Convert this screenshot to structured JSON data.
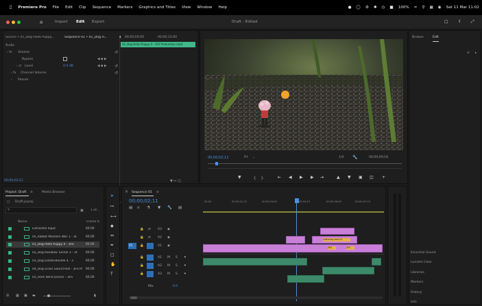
{
  "menubar": {
    "app_name": "Premiere Pro",
    "items": [
      "File",
      "Edit",
      "Clip",
      "Sequence",
      "Markers",
      "Graphics and Titles",
      "View",
      "Window",
      "Help"
    ],
    "battery": "100%",
    "datetime": "Sat 11 Mar 11:02"
  },
  "app_header": {
    "tabs": [
      "Import",
      "Edit",
      "Export"
    ],
    "active_tab": "Edit",
    "doc_title": "Draft - Edited"
  },
  "effect_controls": {
    "source_label": "Source • 01_Dog Hello Puppy...",
    "sequence_label": "Sequence 01 • 01_Dog H...",
    "time_start": "00;00;00;00",
    "time_end": "00;00;15;00",
    "clip_name": "01_Dog Hello Puppy 4 - 3FS Production.mp4",
    "audio_heading": "Audio",
    "volume_label": "Volume",
    "bypass_label": "Bypass",
    "level_label": "Level",
    "level_value": "0.0 dB",
    "channel_volume_label": "Channel Volume",
    "panner_label": "Panner",
    "timecode": "00;00;02;11"
  },
  "program_monitor": {
    "timecode": "00;00;02;11",
    "fit": "Fit",
    "quality": "1/4",
    "duration": "00;00;09;18"
  },
  "right_panel": {
    "tabs": [
      "Browse",
      "Edit"
    ],
    "active_tab": "Edit",
    "items": [
      "Essential Sound",
      "Lumetri Color",
      "Libraries",
      "Markers",
      "History",
      "Info"
    ]
  },
  "project_panel": {
    "tabs": [
      "Project: Draft",
      "Media Browser"
    ],
    "project_file": "Draft.prproj",
    "count_label": "1 of...",
    "col_name": "Name",
    "col_frame_rate": "Frame R",
    "items": [
      {
        "name": "Extracted Input",
        "rate": "60.00"
      },
      {
        "name": "05_Rabbit Mockers War 1 - 3F",
        "rate": "60.00"
      },
      {
        "name": "01_Dog Hello Puppy 4 - 3FS",
        "rate": "60.00"
      },
      {
        "name": "02_Dog Rainbow Tunnel 3 - 3F",
        "rate": "60.00"
      },
      {
        "name": "03_Dog Goldendoodle 4 - 3",
        "rate": "60.00"
      },
      {
        "name": "04_Dog Grass Sound Roll - 3FS Pr",
        "rate": "60.00"
      },
      {
        "name": "05_Hare Wind Dinner - 3FS",
        "rate": "60.00"
      }
    ]
  },
  "timeline": {
    "sequence_name": "Sequence 01",
    "timecode": "00;00;02;11",
    "ruler": [
      "00;00",
      "00;00;01;15",
      "00;00;03;00",
      "00;00;04;15",
      "00;00;06;00",
      "00;00;07;15",
      "00;00;09;00"
    ],
    "video_tracks": [
      "V3",
      "V2",
      "V1"
    ],
    "audio_tracks": [
      "A1",
      "A2",
      "A3"
    ],
    "source_patch": "V1",
    "mix_label": "Mix",
    "mix_value": "0.0",
    "clip_labels": [
      "Lettering text 01",
      "3FS",
      "3FS"
    ]
  },
  "colors": {
    "accent_blue": "#4a90e2",
    "video_clip": "#c97fd8",
    "audio_clip": "#3d8a6a"
  }
}
